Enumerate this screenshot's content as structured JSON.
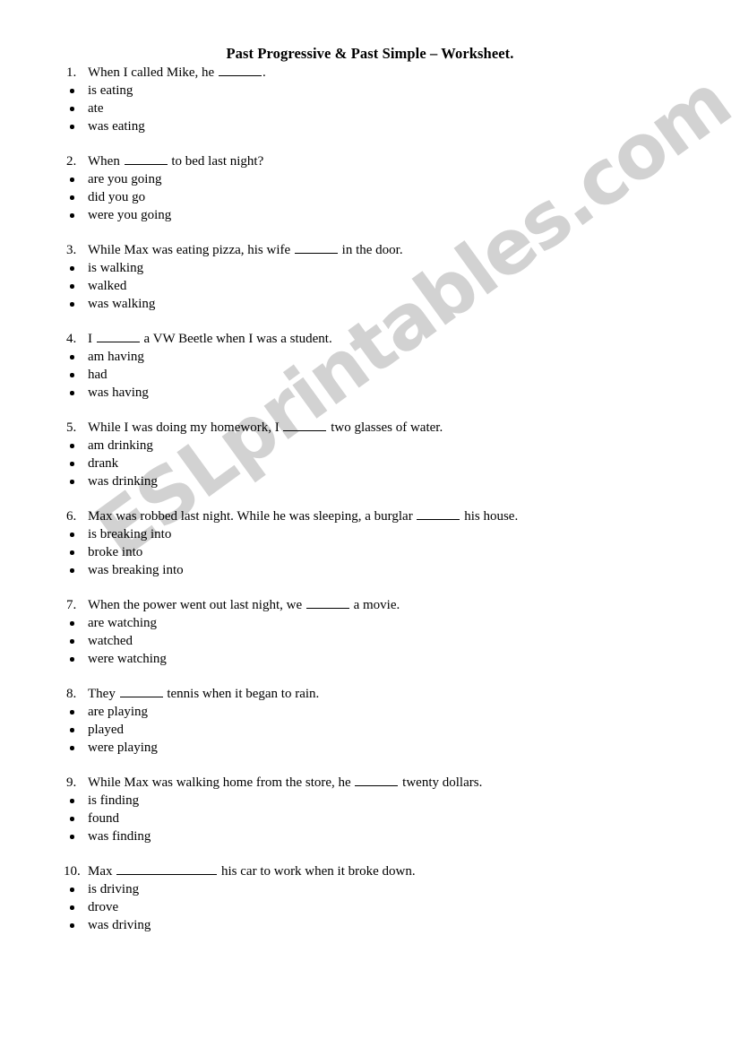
{
  "document": {
    "title": "Past Progressive & Past Simple – Worksheet.",
    "background_color": "#ffffff",
    "text_color": "#000000"
  },
  "watermark": {
    "text": "ESLprintables.com",
    "color": "#d2d2d2"
  },
  "questions": [
    {
      "number": "1.",
      "text_before": "When I called Mike, he ",
      "blank": "_______",
      "blank_length": "standard",
      "text_after": ".",
      "options": [
        "is eating",
        "ate",
        "was eating"
      ]
    },
    {
      "number": "2.",
      "text_before": "When ",
      "blank": "_______",
      "blank_length": "standard",
      "text_after": " to bed last night?",
      "options": [
        "are you going",
        "did you go",
        "were you going"
      ]
    },
    {
      "number": "3.",
      "text_before": "While Max was eating pizza, his wife ",
      "blank": "_______",
      "blank_length": "standard",
      "text_after": " in the door.",
      "options": [
        "is walking",
        "walked",
        "was walking"
      ]
    },
    {
      "number": "4.",
      "text_before": "I ",
      "blank": "_______",
      "blank_length": "standard",
      "text_after": " a VW Beetle when I was a student.",
      "options": [
        "am having",
        "had",
        "was having"
      ]
    },
    {
      "number": "5.",
      "text_before": "While I was doing my homework, I ",
      "blank": "_______",
      "blank_length": "standard",
      "text_after": " two glasses of water.",
      "options": [
        "am drinking",
        "drank",
        "was drinking"
      ]
    },
    {
      "number": "6.",
      "text_before": "Max was robbed last night. While he was sleeping, a burglar ",
      "blank": "_______",
      "blank_length": "standard",
      "text_after": " his house.",
      "options": [
        "is breaking into",
        "broke into",
        "was breaking into"
      ]
    },
    {
      "number": "7.",
      "text_before": "When the power went out last night, we ",
      "blank": "_______",
      "blank_length": "standard",
      "text_after": " a movie.",
      "options": [
        "are watching",
        "watched",
        "were watching"
      ]
    },
    {
      "number": "8.",
      "text_before": "They ",
      "blank": "_______",
      "blank_length": "standard",
      "text_after": " tennis when it began to rain.",
      "options": [
        "are playing",
        "played",
        "were playing"
      ]
    },
    {
      "number": "9.",
      "text_before": "While Max was walking home from the store, he ",
      "blank": "_______",
      "blank_length": "standard",
      "text_after": " twenty dollars.",
      "options": [
        "is finding",
        "found",
        "was finding"
      ]
    },
    {
      "number": "10.",
      "text_before": "Max ",
      "blank": "_______________",
      "blank_length": "long",
      "text_after": " his car to work when it broke down.",
      "options": [
        "is driving",
        "drove",
        "was driving"
      ]
    }
  ]
}
